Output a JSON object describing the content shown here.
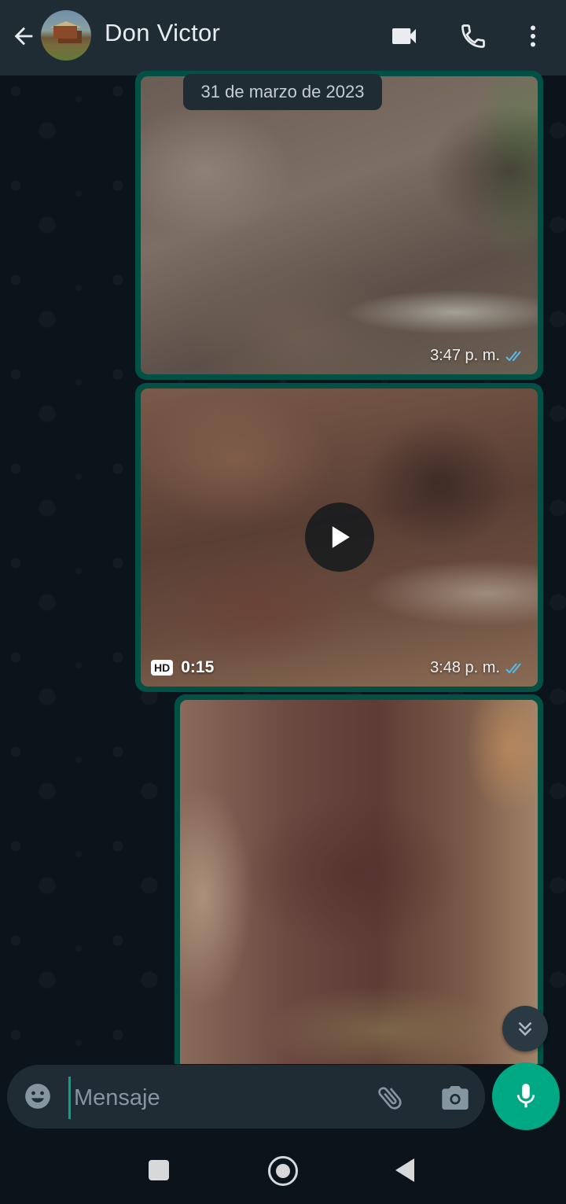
{
  "header": {
    "contact_name": "Don Victor",
    "back_icon": "arrow-left-icon",
    "video_icon": "videocam-icon",
    "call_icon": "phone-icon",
    "menu_icon": "more-vertical-icon"
  },
  "chat": {
    "date_chip": "31 de marzo de 2023",
    "messages": [
      {
        "type": "image",
        "time": "3:47 p. m.",
        "status": "read"
      },
      {
        "type": "video",
        "time": "3:48 p. m.",
        "duration": "0:15",
        "quality_badge": "HD",
        "status": "read"
      },
      {
        "type": "image",
        "time": "",
        "status": ""
      }
    ]
  },
  "composer": {
    "placeholder": "Mensaje",
    "value": "",
    "emoji_icon": "emoji-icon",
    "attach_icon": "paperclip-icon",
    "camera_icon": "camera-icon",
    "mic_icon": "mic-icon"
  },
  "colors": {
    "accent": "#00a884",
    "outgoing_bubble": "#025144",
    "header_bg": "#1f2c34",
    "chat_bg": "#0b141a",
    "read_ticks": "#53bdeb"
  }
}
